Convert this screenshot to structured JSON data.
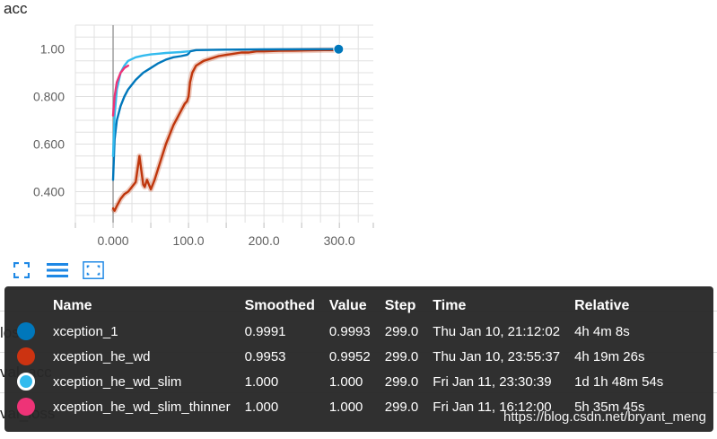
{
  "card": {
    "title": "acc"
  },
  "underlay_labels": [
    "loss",
    "val_acc",
    "val_loss"
  ],
  "toolbar": [
    {
      "name": "expand-icon",
      "color": "#1e88e5"
    },
    {
      "name": "list-icon",
      "color": "#1e88e5"
    },
    {
      "name": "fit-domain-icon",
      "color": "#1e88e5"
    }
  ],
  "chart_data": {
    "type": "line",
    "title": "acc",
    "xlim": [
      -50,
      345
    ],
    "ylim": [
      0.27,
      1.1
    ],
    "x_ticks": [
      0,
      100,
      200,
      300
    ],
    "x_tick_labels": [
      "0.000",
      "100.0",
      "200.0",
      "300.0"
    ],
    "y_ticks": [
      0.4,
      0.6,
      0.8,
      1.0
    ],
    "y_tick_labels": [
      "0.400",
      "0.600",
      "0.800",
      "1.00"
    ],
    "grid": true,
    "series": [
      {
        "name": "xception_he_wd",
        "color": "#bf360c",
        "x": [
          0,
          2,
          5,
          10,
          15,
          20,
          25,
          30,
          35,
          37,
          40,
          42,
          45,
          50,
          55,
          60,
          65,
          70,
          75,
          80,
          85,
          90,
          95,
          98,
          100,
          102,
          105,
          110,
          120,
          130,
          140,
          150,
          160,
          170,
          180,
          190,
          200,
          220,
          240,
          260,
          280,
          299
        ],
        "y": [
          0.33,
          0.32,
          0.34,
          0.37,
          0.39,
          0.4,
          0.42,
          0.44,
          0.55,
          0.5,
          0.43,
          0.42,
          0.45,
          0.41,
          0.45,
          0.5,
          0.55,
          0.6,
          0.64,
          0.68,
          0.71,
          0.74,
          0.77,
          0.78,
          0.8,
          0.86,
          0.9,
          0.93,
          0.95,
          0.96,
          0.97,
          0.975,
          0.98,
          0.985,
          0.985,
          0.99,
          0.99,
          0.992,
          0.993,
          0.994,
          0.995,
          0.9953
        ]
      },
      {
        "name": "xception_1",
        "color": "#0077bb",
        "x": [
          0,
          2,
          5,
          10,
          15,
          20,
          30,
          40,
          50,
          60,
          70,
          80,
          90,
          98,
          100,
          102,
          110,
          150,
          200,
          250,
          299
        ],
        "y": [
          0.45,
          0.62,
          0.7,
          0.76,
          0.8,
          0.83,
          0.87,
          0.9,
          0.92,
          0.94,
          0.955,
          0.965,
          0.97,
          0.975,
          0.98,
          0.99,
          0.995,
          0.997,
          0.998,
          0.999,
          0.9991
        ]
      },
      {
        "name": "xception_he_wd_slim",
        "color": "#33bbee",
        "x": [
          0,
          2,
          5,
          10,
          15,
          20,
          30,
          40,
          50,
          60,
          70,
          80,
          90,
          100
        ],
        "y": [
          0.55,
          0.72,
          0.83,
          0.9,
          0.93,
          0.95,
          0.965,
          0.972,
          0.977,
          0.98,
          0.983,
          0.985,
          0.987,
          0.99
        ]
      },
      {
        "name": "xception_he_wd_slim_thinner",
        "color": "#ee3377",
        "x": [
          0,
          2,
          5,
          10,
          15,
          20
        ],
        "y": [
          0.72,
          0.8,
          0.86,
          0.9,
          0.92,
          0.93
        ]
      }
    ]
  },
  "tooltip": {
    "columns": [
      "Name",
      "Smoothed",
      "Value",
      "Step",
      "Time",
      "Relative"
    ],
    "rows": [
      {
        "name": "xception_1",
        "color": "#0077bb",
        "style": "filled",
        "smoothed": "0.9991",
        "value": "0.9993",
        "step": "299.0",
        "time": "Thu Jan 10, 21:12:02",
        "relative": "4h 4m 8s"
      },
      {
        "name": "xception_he_wd",
        "color": "#cc3311",
        "style": "filled",
        "smoothed": "0.9953",
        "value": "0.9952",
        "step": "299.0",
        "time": "Thu Jan 10, 23:55:37",
        "relative": "4h 19m 26s"
      },
      {
        "name": "xception_he_wd_slim",
        "color": "#33bbee",
        "style": "ring",
        "smoothed": "1.000",
        "value": "1.000",
        "step": "299.0",
        "time": "Fri Jan 11, 23:30:39",
        "relative": "1d 1h 48m 54s"
      },
      {
        "name": "xception_he_wd_slim_thinner",
        "color": "#ee3377",
        "style": "filled",
        "smoothed": "1.000",
        "value": "1.000",
        "step": "299.0",
        "time": "Fri Jan 11, 16:12:00",
        "relative": "5h 35m 45s"
      }
    ]
  },
  "watermark": "https://blog.csdn.net/bryant_meng"
}
